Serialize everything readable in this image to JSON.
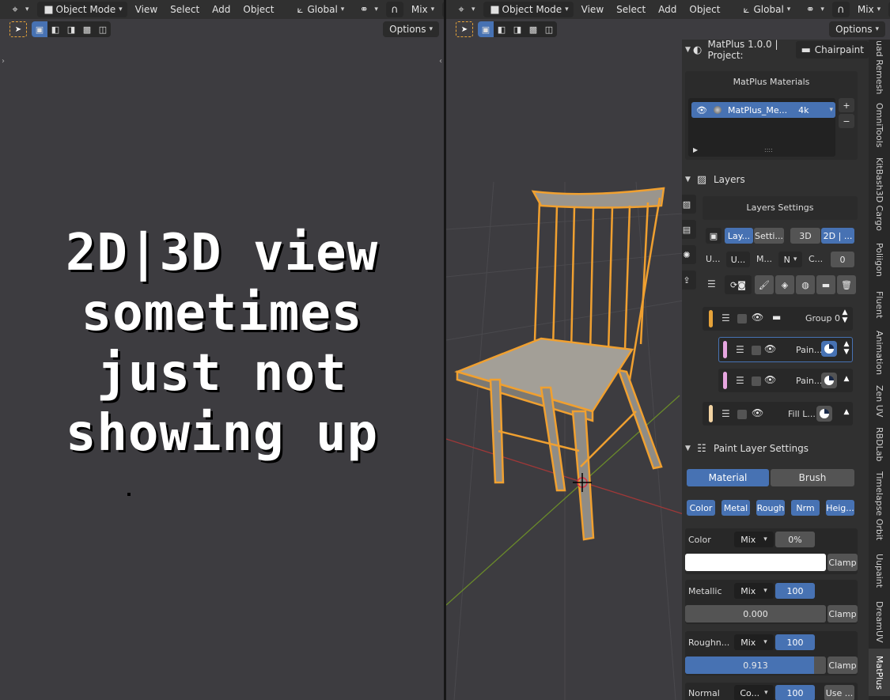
{
  "header": {
    "mode": "Object Mode",
    "menu": [
      "View",
      "Select",
      "Add",
      "Object"
    ],
    "transform": "Global",
    "proportional": "Mix",
    "options": "Options"
  },
  "overlay_text": [
    "2D|3D view",
    "sometimes",
    "just not",
    "showing up"
  ],
  "matplus": {
    "title": "MatPlus 1.0.0 | Project:",
    "project": "Chairpaint",
    "materials_title": "MatPlus Materials",
    "material_name": "MatPlus_Me...",
    "material_res": "4k",
    "plus": "+",
    "minus": "−"
  },
  "layers": {
    "title": "Layers",
    "settings_title": "Layers Settings",
    "tab_layers": "Lay...",
    "tab_settings": "Setti...",
    "tab_3d": "3D",
    "tab_2d": "2D | ...",
    "row2": [
      "U...",
      "U...",
      "M...",
      "N",
      "C...",
      "0"
    ],
    "items": [
      {
        "name": "Group 0",
        "color": "#e6a33a"
      },
      {
        "name": "Pain...",
        "color": "#e7a6e0"
      },
      {
        "name": "Pain...",
        "color": "#e7a6e0"
      },
      {
        "name": "Fill L...",
        "color": "#f2d3a3"
      }
    ]
  },
  "paint_settings": {
    "title": "Paint Layer Settings",
    "material_tab": "Material",
    "brush_tab": "Brush",
    "channels": [
      "Color",
      "Metal",
      "Rough",
      "Nrm",
      "Heig..."
    ],
    "color": {
      "label": "Color",
      "blend": "Mix",
      "opacity": "0%",
      "clamp": "Clamp"
    },
    "metallic": {
      "label": "Metallic",
      "blend": "Mix",
      "opacity": "100",
      "value": "0.000",
      "clamp": "Clamp"
    },
    "roughness": {
      "label": "Roughn...",
      "blend": "Mix",
      "opacity": "100",
      "value": "0.913",
      "value_fraction": 0.913,
      "clamp": "Clamp"
    },
    "normal": {
      "label": "Normal",
      "blend": "Co...",
      "opacity": "100",
      "use": "Use ..."
    }
  },
  "tabs": [
    "uad Remesh",
    "OmniTools",
    "KitBash3D Cargo",
    "Poliigon",
    "Fluent",
    "Animation",
    "Zen UV",
    "RBDLab",
    "Timelapse Orbit",
    "Uupaint",
    "DreamUV",
    "MatPlus"
  ]
}
